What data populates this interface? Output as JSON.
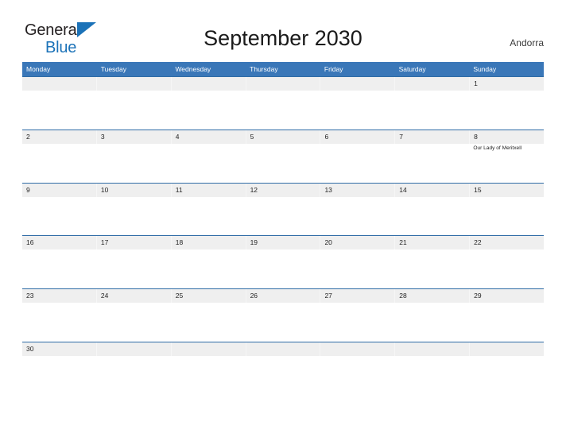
{
  "logo": {
    "word_dark": "General",
    "word_blue": "Blue",
    "flag_icon": "blue-triangle-flag-icon"
  },
  "header": {
    "title": "September 2030",
    "country": "Andorra"
  },
  "colors": {
    "header_blue": "#3a77b8",
    "row_rule_blue": "#2f6ca6",
    "date_band_gray": "#efefef",
    "logo_blue": "#1b72b8",
    "page_background": "#ffffff"
  },
  "calendar": {
    "weekdays": [
      "Monday",
      "Tuesday",
      "Wednesday",
      "Thursday",
      "Friday",
      "Saturday",
      "Sunday"
    ],
    "weeks": [
      [
        {
          "date": "",
          "events": []
        },
        {
          "date": "",
          "events": []
        },
        {
          "date": "",
          "events": []
        },
        {
          "date": "",
          "events": []
        },
        {
          "date": "",
          "events": []
        },
        {
          "date": "",
          "events": []
        },
        {
          "date": "1",
          "events": []
        }
      ],
      [
        {
          "date": "2",
          "events": []
        },
        {
          "date": "3",
          "events": []
        },
        {
          "date": "4",
          "events": []
        },
        {
          "date": "5",
          "events": []
        },
        {
          "date": "6",
          "events": []
        },
        {
          "date": "7",
          "events": []
        },
        {
          "date": "8",
          "events": [
            "Our Lady of Meritxell"
          ]
        }
      ],
      [
        {
          "date": "9",
          "events": []
        },
        {
          "date": "10",
          "events": []
        },
        {
          "date": "11",
          "events": []
        },
        {
          "date": "12",
          "events": []
        },
        {
          "date": "13",
          "events": []
        },
        {
          "date": "14",
          "events": []
        },
        {
          "date": "15",
          "events": []
        }
      ],
      [
        {
          "date": "16",
          "events": []
        },
        {
          "date": "17",
          "events": []
        },
        {
          "date": "18",
          "events": []
        },
        {
          "date": "19",
          "events": []
        },
        {
          "date": "20",
          "events": []
        },
        {
          "date": "21",
          "events": []
        },
        {
          "date": "22",
          "events": []
        }
      ],
      [
        {
          "date": "23",
          "events": []
        },
        {
          "date": "24",
          "events": []
        },
        {
          "date": "25",
          "events": []
        },
        {
          "date": "26",
          "events": []
        },
        {
          "date": "27",
          "events": []
        },
        {
          "date": "28",
          "events": []
        },
        {
          "date": "29",
          "events": []
        }
      ],
      [
        {
          "date": "30",
          "events": []
        },
        {
          "date": "",
          "events": []
        },
        {
          "date": "",
          "events": []
        },
        {
          "date": "",
          "events": []
        },
        {
          "date": "",
          "events": []
        },
        {
          "date": "",
          "events": []
        },
        {
          "date": "",
          "events": []
        }
      ]
    ]
  }
}
